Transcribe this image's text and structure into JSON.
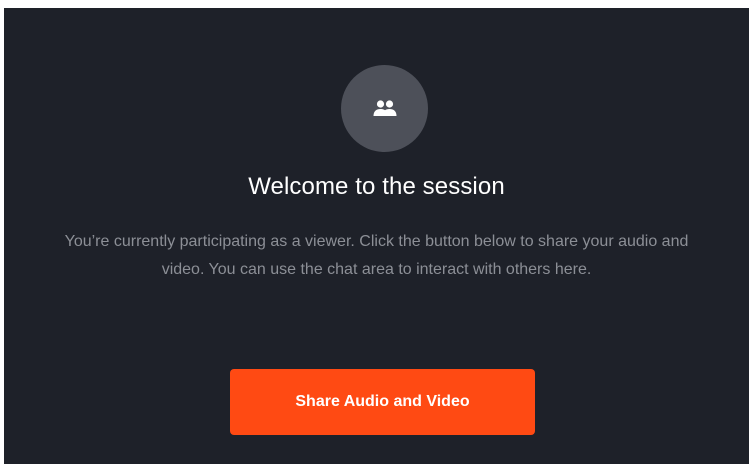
{
  "welcome": {
    "icon": "people-group-icon",
    "title": "Welcome to the session",
    "description": "You’re currently participating as a viewer. Click the button below to share your audio and video. You can use the chat area to interact with others here.",
    "share_button_label": "Share Audio and Video"
  },
  "colors": {
    "background": "#1e2129",
    "icon_circle": "#4d5059",
    "title_text": "#ffffff",
    "description_text": "#8c8f96",
    "accent_button": "#ff4a13"
  }
}
